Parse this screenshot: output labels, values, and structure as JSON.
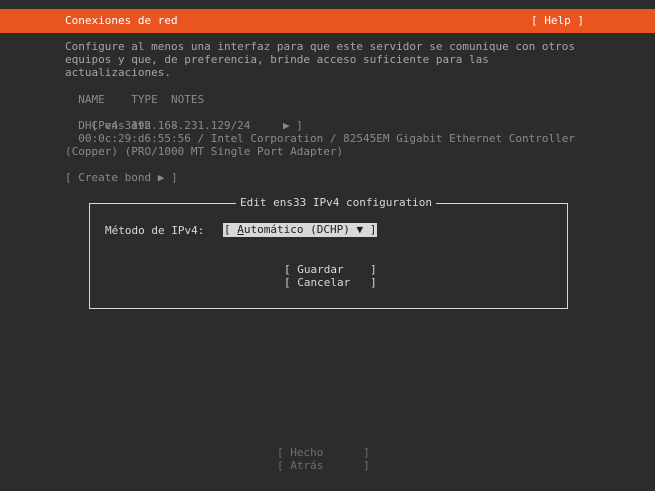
{
  "header": {
    "title": "Conexiones de red",
    "help_label": "[ Help ]"
  },
  "intro": {
    "line1": "Configure al menos una interfaz para que este servidor se comunique con otros",
    "line2": "equipos y que, de preferencia, brinde acceso suficiente para las",
    "line3": "actualizaciones."
  },
  "interfaces": {
    "header_row": "  NAME    TYPE  NOTES",
    "row_prefix": "[ ",
    "name": "ens33",
    "type": "eth",
    "notes": "-",
    "row_suffix": "▶ ]",
    "dhcp_line": "  DHCPv4  192.168.231.129/24",
    "mac_line": "  00:0c:29:d6:55:56 / Intel Corporation / 82545EM Gigabit Ethernet Controller",
    "mac_line2": "(Copper) (PRO/1000 MT Single Port Adapter)"
  },
  "create_bond": "[ Create bond ▶ ]",
  "dialog": {
    "title": "Edit ens33 IPv4 configuration",
    "method_label": "Método de IPv4:",
    "method_prefix": "[ ",
    "method_first_letter": "A",
    "method_rest": "utomático (DCHP) ▼ ]",
    "save_label": "[ Guardar    ]",
    "cancel_label": "[ Cancelar   ]"
  },
  "footer": {
    "done_label": "[ Hecho      ]",
    "back_label": "[ Atrás      ]"
  },
  "colors": {
    "header_bg": "#e95420",
    "background": "#2c2c2c",
    "text": "#a6a6a6",
    "highlight": "#d8d8d8"
  }
}
